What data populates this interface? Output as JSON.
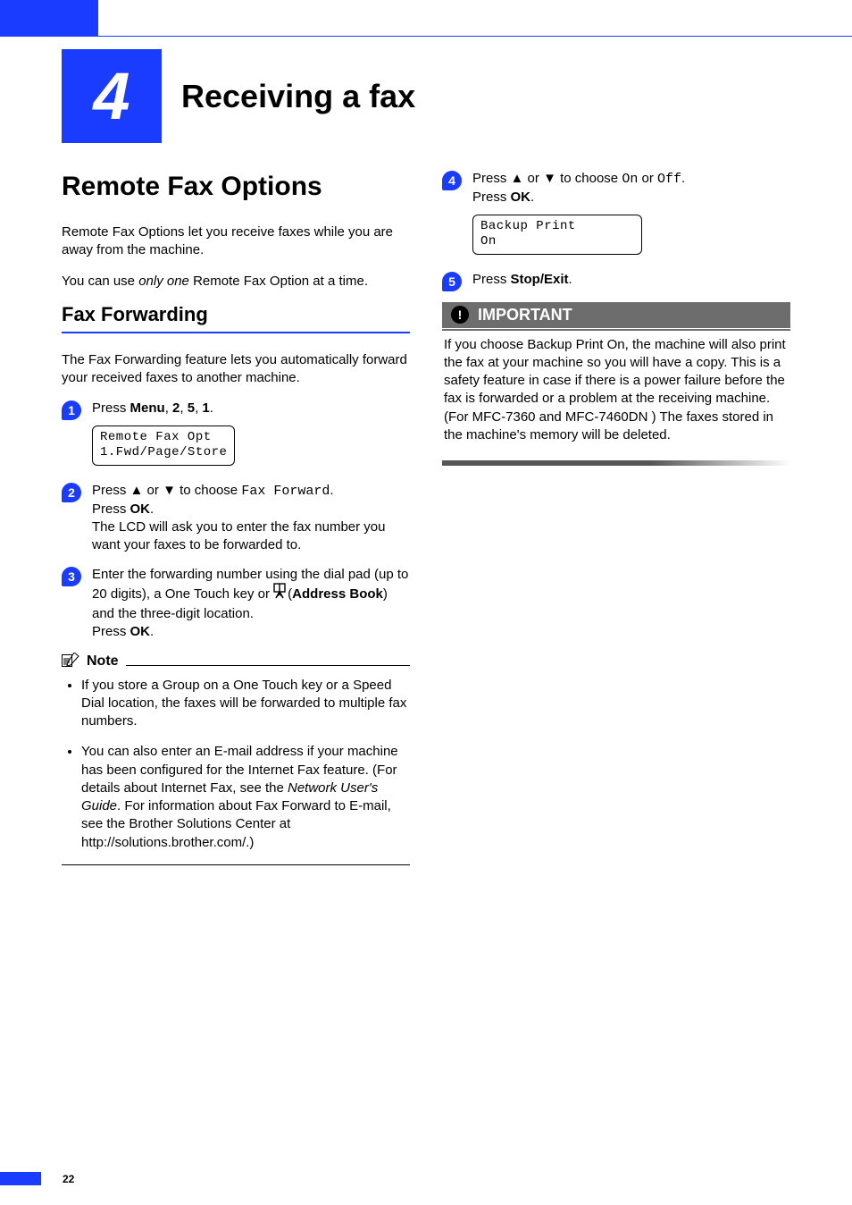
{
  "chapter": {
    "number": "4",
    "title": "Receiving a fax"
  },
  "left": {
    "h1": "Remote Fax Options",
    "intro1": "Remote Fax Options let you receive faxes while you are away from the machine.",
    "intro2_a": "You can use ",
    "intro2_em": "only one",
    "intro2_b": " Remote Fax Option at a time.",
    "h2": "Fax Forwarding",
    "desc": "The Fax Forwarding feature lets you automatically forward your received faxes to another machine.",
    "step1_a": "Press ",
    "step1_menu": "Menu",
    "step1_b": ", ",
    "step1_2": "2",
    "step1_c": ", ",
    "step1_5": "5",
    "step1_d": ", ",
    "step1_1": "1",
    "step1_e": ".",
    "lcd1_line1": "Remote Fax Opt",
    "lcd1_line2": "1.Fwd/Page/Store",
    "step2_a": "Press ",
    "step2_up": "▲",
    "step2_b": " or ",
    "step2_dn": "▼",
    "step2_c": " to choose ",
    "step2_val": "Fax Forward",
    "step2_d": ".",
    "step2_line2a": "Press ",
    "step2_ok": "OK",
    "step2_line2b": ".",
    "step2_line3": "The LCD will ask you to enter the fax number you want your faxes to be forwarded to.",
    "step3_a": "Enter the forwarding number using the dial pad (up to 20 digits), a One Touch key or ",
    "step3_ab": "Address Book",
    "step3_b": ") and the three-digit location.",
    "step3_line2a": "Press ",
    "step3_ok": "OK",
    "step3_line2b": ".",
    "note_title": "Note",
    "note1": "If you store a Group on a One Touch key or a Speed Dial location, the faxes will be forwarded to multiple fax numbers.",
    "note2_a": "You can also enter an E-mail address if your machine has been configured for the Internet Fax feature. (For details about Internet Fax, see the ",
    "note2_em": "Network User's Guide",
    "note2_b": ". For information about Fax Forward to E-mail, see the Brother Solutions Center at http://solutions.brother.com/.)"
  },
  "right": {
    "step4_a": "Press ",
    "step4_up": "▲",
    "step4_b": " or ",
    "step4_dn": "▼",
    "step4_c": " to choose ",
    "step4_on": "On",
    "step4_d": " or ",
    "step4_off": "Off",
    "step4_e": ".",
    "step4_line2a": "Press ",
    "step4_ok": "OK",
    "step4_line2b": ".",
    "lcd2_line1": "Backup Print",
    "lcd2_line2": "On",
    "step5_a": "Press ",
    "step5_se": "Stop/Exit",
    "step5_b": ".",
    "important_label": "IMPORTANT",
    "important_body": "If you choose Backup Print On, the machine will also print the fax at your machine so you will have a copy. This is a safety feature in case if there is a power failure before the fax is forwarded or a problem at the receiving machine. (For MFC-7360 and MFC-7460DN ) The faxes stored in the machine's memory will be deleted."
  },
  "page_number": "22"
}
